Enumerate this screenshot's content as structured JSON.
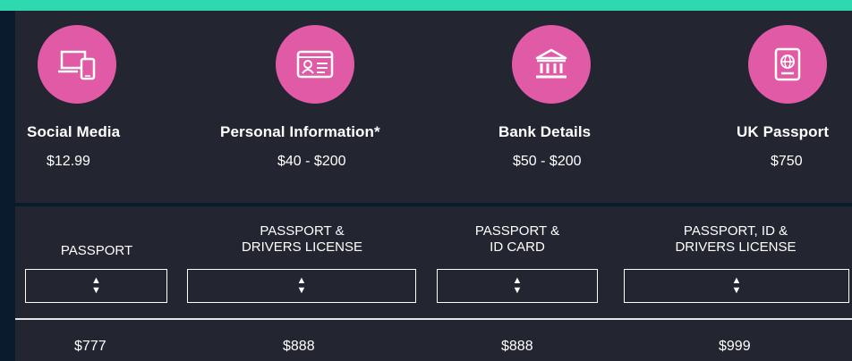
{
  "services": [
    {
      "name": "Social Media",
      "price": "$12.99",
      "icon": "devices-icon"
    },
    {
      "name": "Personal Information*",
      "price": "$40 - $200",
      "icon": "id-card-icon"
    },
    {
      "name": "Bank Details",
      "price": "$50 - $200",
      "icon": "bank-icon"
    },
    {
      "name": "UK Passport",
      "price": "$750",
      "icon": "passport-icon"
    }
  ],
  "packages": [
    {
      "label_line1": "PASSPORT",
      "label_line2": "",
      "select_value": "",
      "price": "$777"
    },
    {
      "label_line1": "PASSPORT &",
      "label_line2": "DRIVERS LICENSE",
      "select_value": "",
      "price": "$888"
    },
    {
      "label_line1": "PASSPORT &",
      "label_line2": "ID CARD",
      "select_value": "",
      "price": "$888"
    },
    {
      "label_line1": "PASSPORT, ID &",
      "label_line2": "DRIVERS LICENSE",
      "select_value": "",
      "price": "$999"
    }
  ],
  "colors": {
    "accent_top": "#2fd9b0",
    "icon_circle": "#e15aa5",
    "panel": "#232530",
    "background": "#0b1b2e"
  }
}
